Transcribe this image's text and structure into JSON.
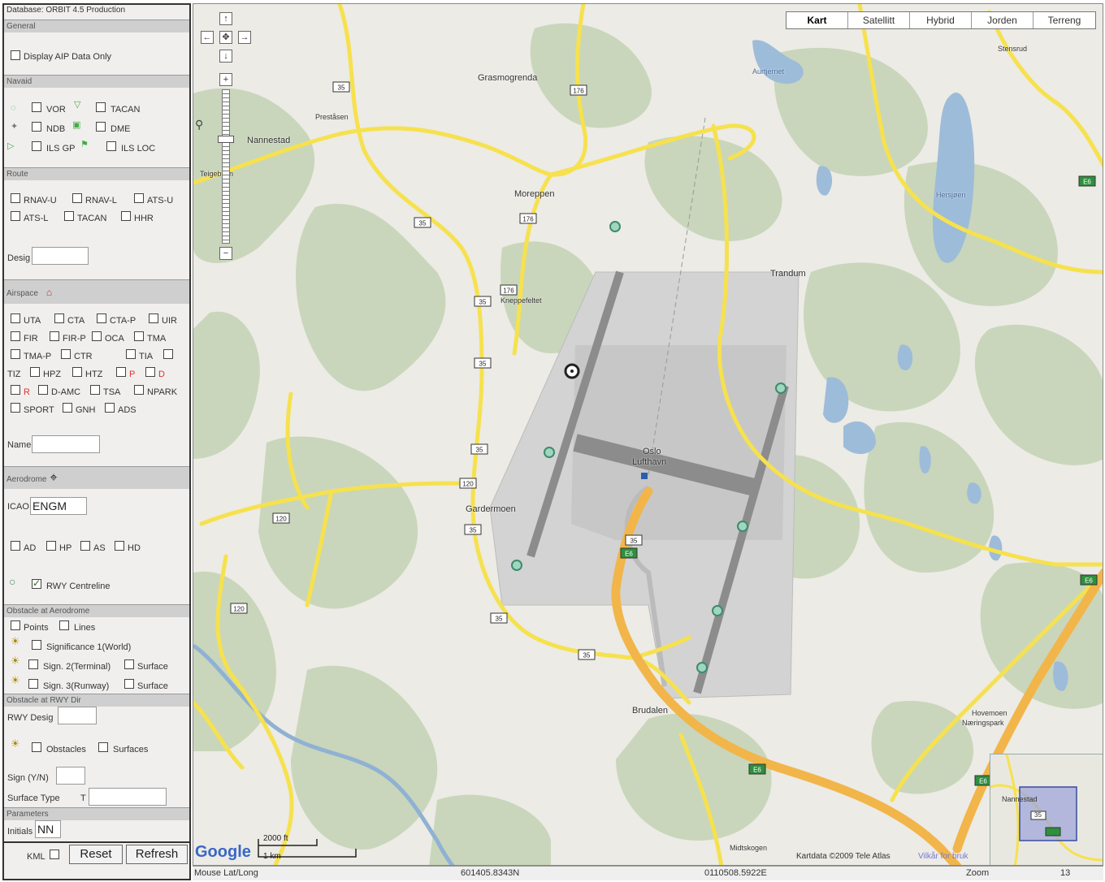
{
  "panel": {
    "database": "Database: ORBIT 4.5 Production",
    "general": {
      "header": "General",
      "display_aip": "Display AIP Data Only"
    },
    "navaid": {
      "header": "Navaid",
      "vor": "VOR",
      "tacan": "TACAN",
      "ndb": "NDB",
      "dme": "DME",
      "ils_gp": "ILS GP",
      "ils_loc": "ILS LOC"
    },
    "route": {
      "header": "Route",
      "rnav_u": "RNAV-U",
      "rnav_l": "RNAV-L",
      "ats_u": "ATS-U",
      "ats_l": "ATS-L",
      "tacan": "TACAN",
      "hhr": "HHR",
      "desig_label": "Desig",
      "desig_value": ""
    },
    "airspace": {
      "header": "Airspace",
      "row1": [
        "UTA",
        "CTA",
        "CTA-P",
        "UIR"
      ],
      "row2": [
        "FIR",
        "FIR-P",
        "OCA",
        "TMA"
      ],
      "row3": [
        "TMA-P",
        "CTR",
        "TIA",
        ""
      ],
      "row4": [
        "TIZ",
        "HPZ",
        "HTZ",
        "P",
        "D"
      ],
      "row5": [
        "R",
        "D-AMC",
        "TSA",
        "NPARK"
      ],
      "row6": [
        "SPORT",
        "GNH",
        "ADS"
      ],
      "name_label": "Name",
      "name_value": ""
    },
    "aerodrome": {
      "header": "Aerodrome",
      "icao_label": "ICAO",
      "icao_value": "ENGM",
      "ad": "AD",
      "hp": "HP",
      "as": "AS",
      "hd": "HD",
      "rwy_centreline": "RWY Centreline"
    },
    "obstacle_ad": {
      "header": "Obstacle at Aerodrome",
      "points": "Points",
      "lines": "Lines",
      "sig1": "Significance 1(World)",
      "sig2": "Sign. 2(Terminal)",
      "sig3": "Sign. 3(Runway)",
      "surface": "Surface"
    },
    "obstacle_rwy": {
      "header": "Obstacle at RWY Dir",
      "rwy_desig": "RWY Desig",
      "obstacles": "Obstacles",
      "surfaces": "Surfaces",
      "sign": "Sign (Y/N)",
      "surface_type": "Surface Type",
      "surface_type_prefix": "T"
    },
    "parameters": {
      "header": "Parameters",
      "initials_label": "Initials",
      "initials_value": "NN"
    },
    "kml": "KML",
    "reset": "Reset",
    "refresh": "Refresh"
  },
  "map": {
    "tabs": [
      "Kart",
      "Satellitt",
      "Hybrid",
      "Jorden",
      "Terreng"
    ],
    "active_tab": "Kart",
    "places": {
      "nannestad": "Nannestad",
      "prestasen": "Preståsen",
      "grasmogrenda": "Grasmogrenda",
      "moreppen": "Moreppen",
      "kneppefeltet": "Kneppefeltet",
      "gardermoen": "Gardermoen",
      "oslo": "Oslo",
      "lufthavn": "Lufthavn",
      "brudalen": "Brudalen",
      "trandum": "Trandum",
      "hovemoen": "Hovemoen",
      "naeringspark": "Næringspark",
      "midtskogen": "Midtskogen",
      "aurtjernet": "Aurtjernet",
      "hersjoen": "Hersjøen",
      "stensrud": "Stensrud",
      "teigebyen": "Teigebyen"
    },
    "road_numbers": [
      "35",
      "176",
      "120",
      "E6"
    ],
    "scale_ft": "2000 ft",
    "scale_km": "1 km",
    "copyright": "Kartdata ©2009 Tele Atlas",
    "terms": "Vilkår for bruk",
    "minimap_place": "Nannestad"
  },
  "status": {
    "mouse_label": "Mouse Lat/Long",
    "lat": "601405.8343N",
    "lon": "0110508.5922E",
    "zoom_label": "Zoom",
    "zoom_value": "13"
  },
  "colors": {
    "road_yellow": "#f7e84f",
    "motorway_orange": "#f5b74a",
    "water": "#9bbcdc",
    "forest": "#c8d5ba",
    "airport": "#c9c9c9",
    "runway": "#8f8f8f"
  }
}
